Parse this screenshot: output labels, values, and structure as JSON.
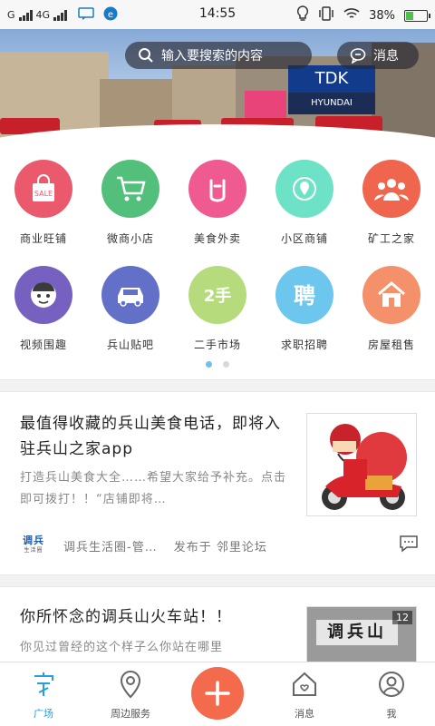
{
  "status_bar": {
    "carrier_left": "G",
    "network": "4G",
    "time": "14:55",
    "battery": "38%",
    "battery_level": 0.38
  },
  "header": {
    "search_placeholder": "输入要搜索的内容",
    "messages_label": "消息"
  },
  "banner": {
    "billboard_text": "TDK",
    "billboard_sub": "HYUNDAI"
  },
  "categories": [
    {
      "label": "商业旺铺",
      "icon": "sale-bag-icon",
      "color": "#ea5a6c",
      "icon_text": "SALE"
    },
    {
      "label": "微商小店",
      "icon": "shopping-cart-icon",
      "color": "#52c07a"
    },
    {
      "label": "美食外卖",
      "icon": "takeaway-icon",
      "color": "#ef5a90"
    },
    {
      "label": "小区商铺",
      "icon": "location-pin-icon",
      "color": "#6ee2c6"
    },
    {
      "label": "矿工之家",
      "icon": "people-icon",
      "color": "#f0654e"
    },
    {
      "label": "视频围趣",
      "icon": "face-icon",
      "color": "#7660c0"
    },
    {
      "label": "兵山贴吧",
      "icon": "car-icon",
      "color": "#6370c8"
    },
    {
      "label": "二手市场",
      "icon": "second-hand-icon",
      "color": "#b6db7c",
      "icon_text": "2手"
    },
    {
      "label": "求职招聘",
      "icon": "recruit-icon",
      "color": "#6dc6ee",
      "icon_text": "聘"
    },
    {
      "label": "房屋租售",
      "icon": "house-icon",
      "color": "#f4906a"
    }
  ],
  "articles": [
    {
      "title": "最值得收藏的兵山美食电话，即将入驻兵山之家app",
      "description": "打造兵山美食大全……希望大家给予补充。点击即可拨打！！“店铺即将…",
      "source": "调兵生活圈-管…",
      "published_in": "发布于 邻里论坛",
      "source_logo_text": "调兵",
      "source_logo_sub": "生活圈"
    },
    {
      "title": "你所怀念的调兵山火车站！！",
      "description": "你见过曾经的这个样子么你站在哪里",
      "thumb_badge": "12",
      "thumb_sign": "调兵山"
    }
  ],
  "bottom_nav": [
    {
      "label": "广场",
      "icon": "plaza-icon",
      "active": true
    },
    {
      "label": "周边服务",
      "icon": "map-pin-icon",
      "active": false
    },
    {
      "label": "",
      "icon": "plus-icon",
      "active": false
    },
    {
      "label": "消息",
      "icon": "message-house-icon",
      "active": false
    },
    {
      "label": "我",
      "icon": "user-icon",
      "active": false
    }
  ],
  "colors": {
    "accent": "#2a9de0",
    "fab": "#f36a4c"
  }
}
